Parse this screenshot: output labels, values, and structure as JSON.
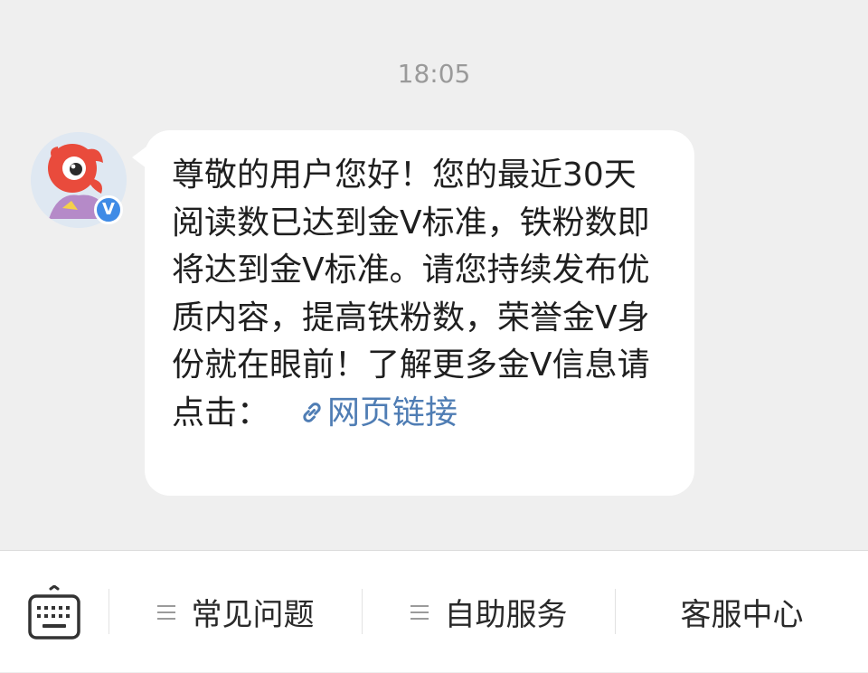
{
  "chat": {
    "timestamp": "18:05",
    "verified_badge": "V",
    "message": {
      "text": "尊敬的用户您好！您的最近30天阅读数已达到金V标准，铁粉数即将达到金V标准。请您持续发布优质内容，提高铁粉数，荣誉金V身份就在眼前！了解更多金V信息请点击：",
      "link_label": "网页链接",
      "link_icon": "link-icon"
    }
  },
  "bottom_bar": {
    "keyboard_icon": "keyboard-icon",
    "items": [
      {
        "label": "常见问题",
        "icon": "menu-icon"
      },
      {
        "label": "自助服务",
        "icon": "menu-icon"
      },
      {
        "label": "客服中心"
      }
    ]
  },
  "colors": {
    "background": "#efefef",
    "bubble": "#ffffff",
    "link": "#4f7db4",
    "verified": "#3f8be6",
    "mascot": "#e94b3c"
  }
}
